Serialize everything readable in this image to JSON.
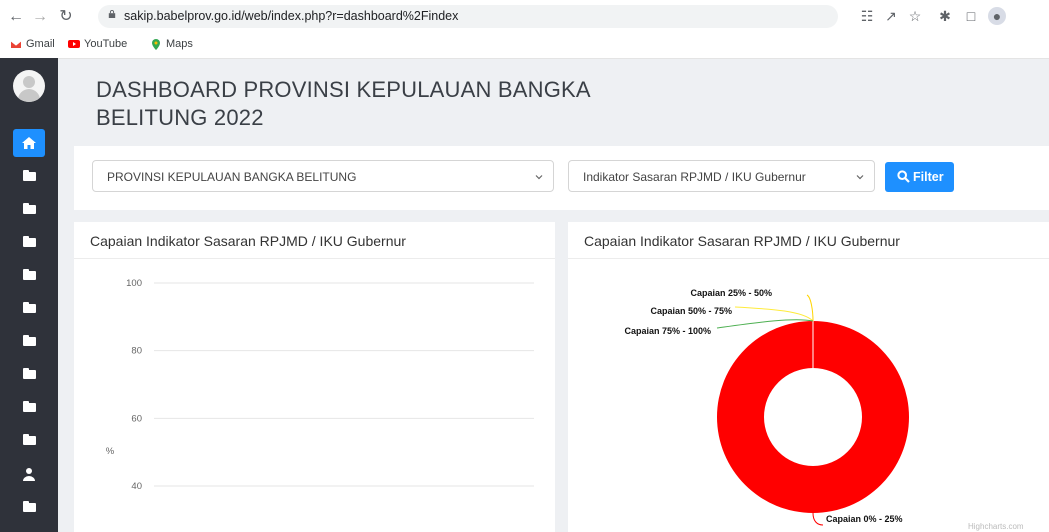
{
  "browser": {
    "url": "sakip.babelprov.go.id/web/index.php?r=dashboard%2Findex",
    "bookmarks": [
      {
        "label": "Gmail",
        "icon": "gmail-icon"
      },
      {
        "label": "YouTube",
        "icon": "youtube-icon"
      },
      {
        "label": "Maps",
        "icon": "maps-icon"
      }
    ]
  },
  "sidebar": {
    "items": [
      {
        "icon": "home-icon",
        "active": true
      },
      {
        "icon": "folder-icon"
      },
      {
        "icon": "folder-icon"
      },
      {
        "icon": "folder-icon"
      },
      {
        "icon": "folder-icon"
      },
      {
        "icon": "folder-icon"
      },
      {
        "icon": "folder-icon"
      },
      {
        "icon": "folder-icon"
      },
      {
        "icon": "folder-icon"
      },
      {
        "icon": "folder-icon"
      },
      {
        "icon": "user-icon"
      },
      {
        "icon": "folder-icon"
      }
    ],
    "accent": "#1e90ff",
    "background": "#2f323a"
  },
  "page": {
    "title": "DASHBOARD PROVINSI KEPULAUAN BANGKA BELITUNG 2022"
  },
  "filters": {
    "region_select": "PROVINSI KEPULAUAN BANGKA BELITUNG",
    "indicator_select": "Indikator Sasaran RPJMD / IKU Gubernur",
    "filter_button": "Filter"
  },
  "left_card": {
    "title": "Capaian Indikator Sasaran RPJMD / IKU Gubernur"
  },
  "right_card": {
    "title": "Capaian Indikator Sasaran RPJMD / IKU Gubernur",
    "credit": "Highcharts.com"
  },
  "chart_data": [
    {
      "type": "bar",
      "title": "",
      "ylabel": "%",
      "yticks": [
        100,
        80,
        60,
        40
      ],
      "series": []
    },
    {
      "type": "pie",
      "donut": true,
      "labels": [
        "Capaian 0% - 25%",
        "Capaian 25% - 50%",
        "Capaian 50% - 75%",
        "Capaian 75% - 100%"
      ],
      "values": [
        100,
        0,
        0,
        0
      ],
      "colors": [
        "#ff0000",
        "#ffd400",
        "#ffeb3b",
        "#4caf50"
      ]
    }
  ]
}
